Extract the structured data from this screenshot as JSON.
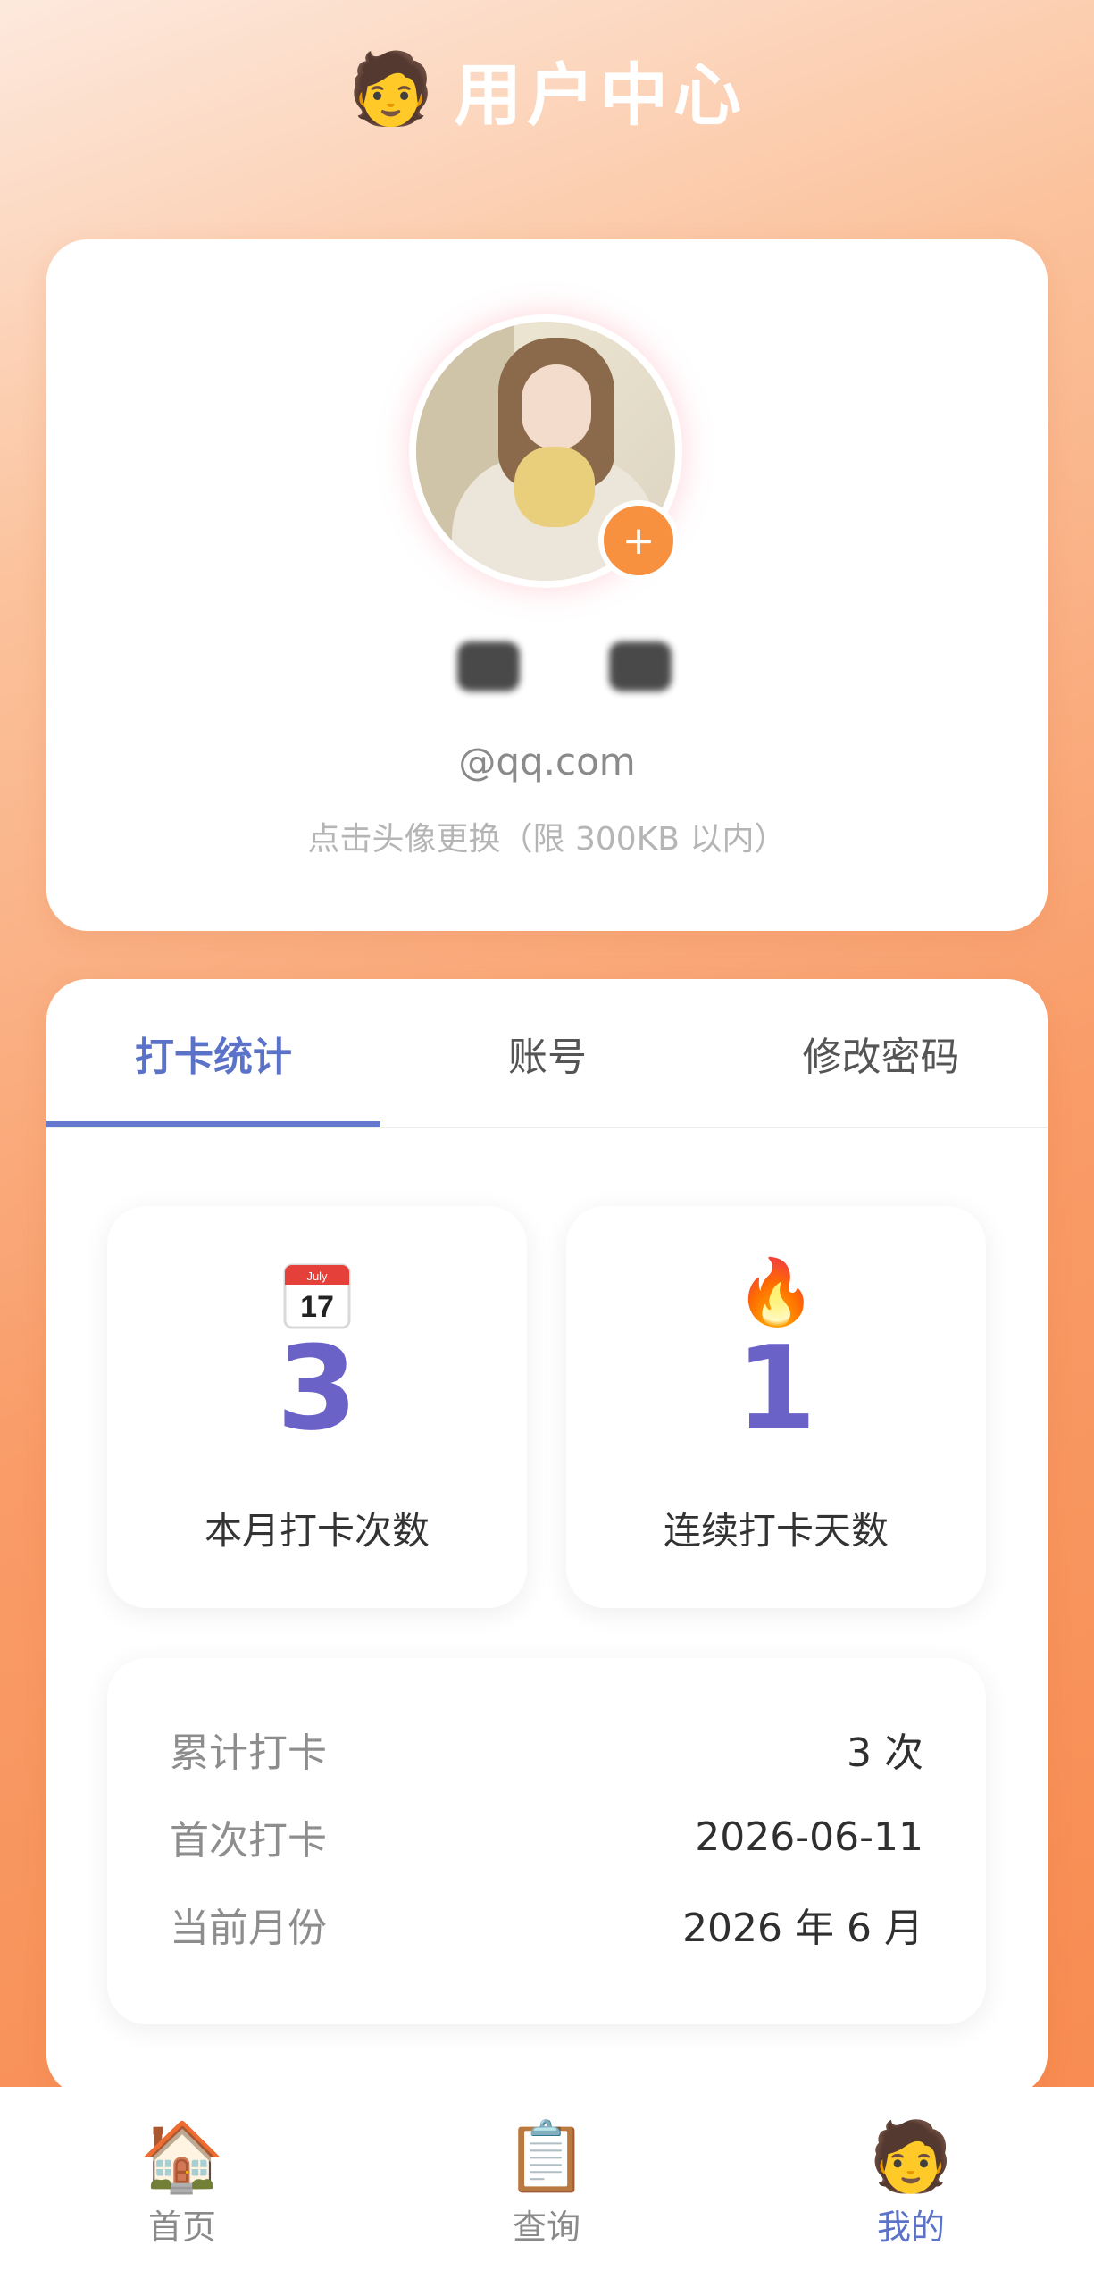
{
  "header": {
    "icon": "person-emoji",
    "emoji": "🧑",
    "title": "用户中心"
  },
  "profile": {
    "avatar_add_label": "+",
    "email": "@qq.com",
    "hint": "点击头像更换（限 300KB 以内）"
  },
  "tabs": [
    {
      "label": "打卡统计",
      "active": true
    },
    {
      "label": "账号",
      "active": false
    },
    {
      "label": "修改密码",
      "active": false
    }
  ],
  "stats": {
    "monthly": {
      "icon": "calendar-icon",
      "emoji": "📅",
      "calendar_month": "July",
      "calendar_day": "17",
      "value": "3",
      "label": "本月打卡次数"
    },
    "streak": {
      "icon": "fire-icon",
      "emoji": "🔥",
      "value": "1",
      "label": "连续打卡天数"
    }
  },
  "info": [
    {
      "key": "累计打卡",
      "value": "3 次"
    },
    {
      "key": "首次打卡",
      "value": "2026-06-11"
    },
    {
      "key": "当前月份",
      "value": "2026 年 6 月"
    }
  ],
  "nav": [
    {
      "icon": "home-icon",
      "emoji": "🏠",
      "label": "首页",
      "active": false
    },
    {
      "icon": "clipboard-icon",
      "emoji": "📋",
      "label": "查询",
      "active": false
    },
    {
      "icon": "person-icon",
      "emoji": "🧑",
      "label": "我的",
      "active": true
    }
  ],
  "colors": {
    "accent": "#5b72c9",
    "number": "#6b62c8",
    "orange": "#f7913f",
    "background_top": "#fde9dd",
    "background_bottom": "#f7894d"
  }
}
